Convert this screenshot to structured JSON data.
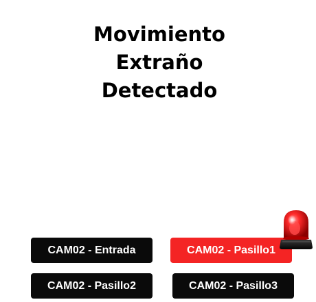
{
  "alert": {
    "title_lines": [
      "Movimiento",
      "Extraño",
      "Detectado"
    ],
    "accent_color": "#f42424"
  },
  "cameras": [
    {
      "label": "CAM02 - Entrada",
      "active": false
    },
    {
      "label": "CAM02 - Pasillo1",
      "active": true
    },
    {
      "label": "CAM02 - Pasillo2",
      "active": false
    },
    {
      "label": "CAM02 - Pasillo3",
      "active": false
    }
  ],
  "icons": {
    "alarm": "siren-icon"
  }
}
